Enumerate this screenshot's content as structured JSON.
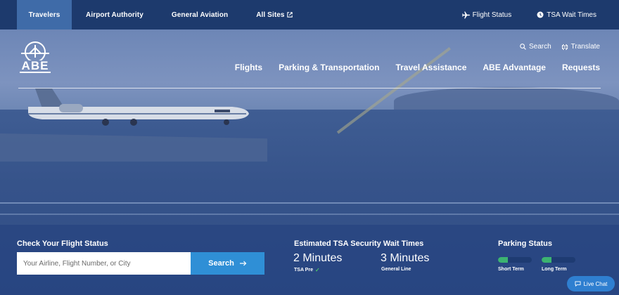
{
  "topbar": {
    "tabs": [
      {
        "label": "Travelers"
      },
      {
        "label": "Airport Authority"
      },
      {
        "label": "General Aviation"
      },
      {
        "label": "All Sites"
      }
    ],
    "flight_status": "Flight Status",
    "tsa_wait": "TSA Wait Times"
  },
  "header": {
    "logo_text": "ABE",
    "search": "Search",
    "translate": "Translate",
    "nav": [
      "Flights",
      "Parking & Transportation",
      "Travel Assistance",
      "ABE Advantage",
      "Requests"
    ]
  },
  "flight_status": {
    "title": "Check Your Flight Status",
    "placeholder": "Your Airline, Flight Number, or City",
    "button": "Search"
  },
  "tsa": {
    "title": "Estimated TSA Security Wait Times",
    "items": [
      {
        "time": "2 Minutes",
        "label": "TSA Pre"
      },
      {
        "time": "3 Minutes",
        "label": "General Line"
      }
    ]
  },
  "parking": {
    "title": "Parking Status",
    "lots": [
      {
        "label": "Short Term",
        "occupancy": 0.3
      },
      {
        "label": "Long Term",
        "occupancy": 0.3
      }
    ]
  },
  "chat": {
    "label": "Live Chat"
  },
  "colors": {
    "navy": "#1d3a6d",
    "active_tab": "#3f6ba8",
    "button_blue": "#2f8fd6",
    "status_green": "#3cb371"
  }
}
